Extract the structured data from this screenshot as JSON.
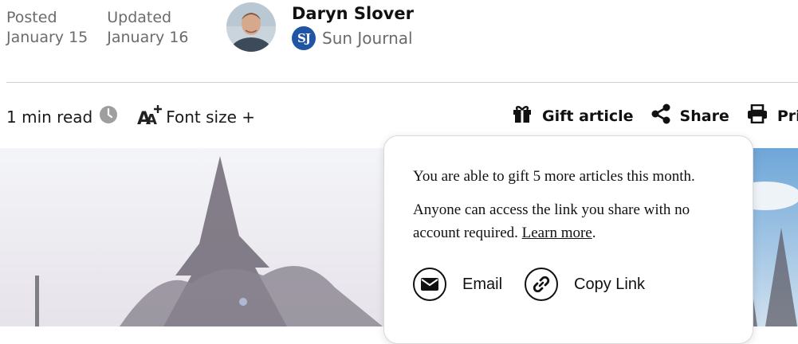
{
  "meta": {
    "posted_label": "Posted",
    "posted_date": "January 15",
    "updated_label": "Updated",
    "updated_date": "January 16"
  },
  "author": {
    "name": "Daryn Slover",
    "publication_logo": "SJ",
    "publication": "Sun Journal"
  },
  "toolbar": {
    "read_time": "1 min read",
    "font_size_label": "Font size +",
    "gift_label": "Gift article",
    "share_label": "Share",
    "print_label": "Print"
  },
  "gift_popup": {
    "remaining_text": "You are able to gift 5 more articles this month.",
    "access_text": "Anyone can access the link you share with no account required.",
    "learn_more": "Learn more",
    "period": ".",
    "email_label": "Email",
    "copy_link_label": "Copy Link"
  },
  "colors": {
    "publication_blue": "#1f55a4",
    "muted_text": "#6b6b6b",
    "divider": "#cfcfcf"
  },
  "icons": [
    "clock-icon",
    "font-size-icon",
    "gift-icon",
    "share-icon",
    "print-icon",
    "email-icon",
    "link-icon"
  ]
}
